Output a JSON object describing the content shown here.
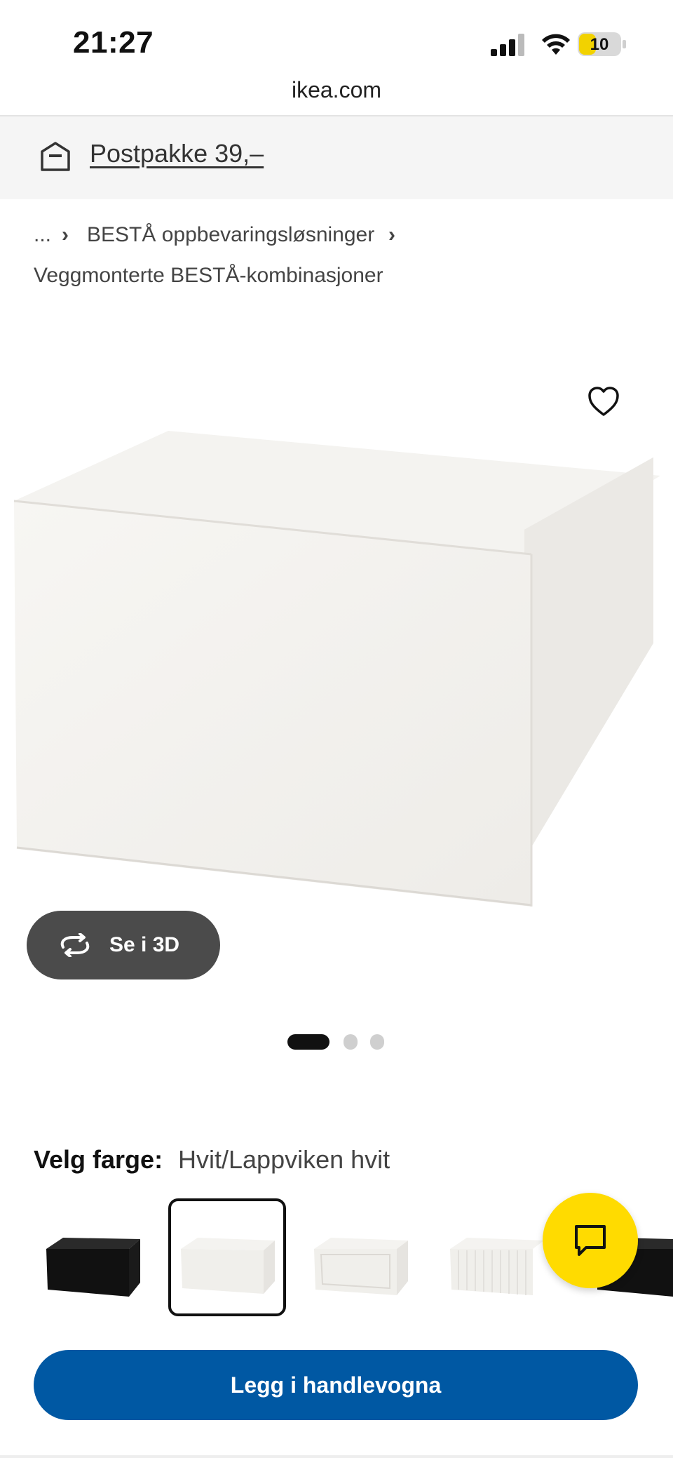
{
  "status_bar": {
    "time": "21:27",
    "battery": "10"
  },
  "browser": {
    "url": "ikea.com"
  },
  "banner": {
    "text": "Postpakke 39,–"
  },
  "breadcrumb": {
    "ellipsis": "...",
    "separator": "›",
    "link": "BESTÅ oppbevaringsløsninger",
    "current": "Veggmonterte BESTÅ-kombinasjoner"
  },
  "product": {
    "view_3d_label": "Se i 3D",
    "carousel": {
      "count": 3,
      "active": 1
    }
  },
  "color": {
    "label": "Velg farge:",
    "value": "Hvit/Lappviken hvit",
    "swatches": [
      "black",
      "white-selected",
      "white-framed",
      "white-ribbed",
      "black"
    ]
  },
  "cart": {
    "button_label": "Legg i handlevogna"
  },
  "colors": {
    "ikea_blue": "#0058a3",
    "ikea_yellow": "#ffdb00",
    "dark_button": "#4b4b4b"
  }
}
